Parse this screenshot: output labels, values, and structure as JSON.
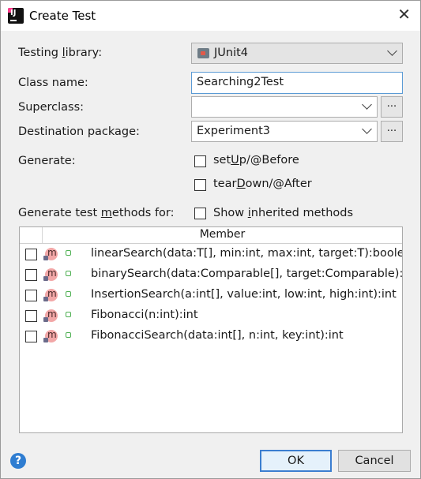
{
  "window": {
    "title": "Create Test",
    "close_glyph": "✕",
    "app_icon_text": "IJ"
  },
  "form": {
    "testing_library": {
      "label_pre": "Testing ",
      "label_u": "l",
      "label_post": "ibrary:",
      "value": "JUnit4"
    },
    "class_name": {
      "label": "Class name:",
      "value": "Searching2Test"
    },
    "superclass": {
      "label": "Superclass:",
      "value": "",
      "browse": "..."
    },
    "destination": {
      "label": "Destination package:",
      "value": "Experiment3",
      "browse": "..."
    },
    "generate": {
      "label": "Generate:",
      "setup": {
        "pre": "set",
        "u": "U",
        "post": "p/@Before",
        "checked": false
      },
      "teardown": {
        "pre": "tear",
        "u": "D",
        "post": "own/@After",
        "checked": false
      }
    },
    "methods_for": {
      "pre": "Generate test ",
      "u": "m",
      "post": "ethods for:"
    },
    "show_inherited": {
      "pre": "Show ",
      "u": "i",
      "post": "nherited methods",
      "checked": false
    }
  },
  "table": {
    "header": "Member",
    "rows": [
      {
        "signature": "linearSearch(data:T[], min:int, max:int, target:T):boolean",
        "checked": false
      },
      {
        "signature": "binarySearch(data:Comparable[], target:Comparable):Comparable",
        "checked": false
      },
      {
        "signature": "InsertionSearch(a:int[], value:int, low:int, high:int):int",
        "checked": false
      },
      {
        "signature": "Fibonacci(n:int):int",
        "checked": false
      },
      {
        "signature": "FibonacciSearch(data:int[], n:int, key:int):int",
        "checked": false
      }
    ],
    "method_icon_letter": "m"
  },
  "footer": {
    "help": "?",
    "ok": "OK",
    "cancel": "Cancel"
  },
  "colors": {
    "accent": "#3b7ed0",
    "help": "#2f7dd1",
    "method_icon": "#f2a7a7",
    "visibility_icon": "#4caf50"
  }
}
